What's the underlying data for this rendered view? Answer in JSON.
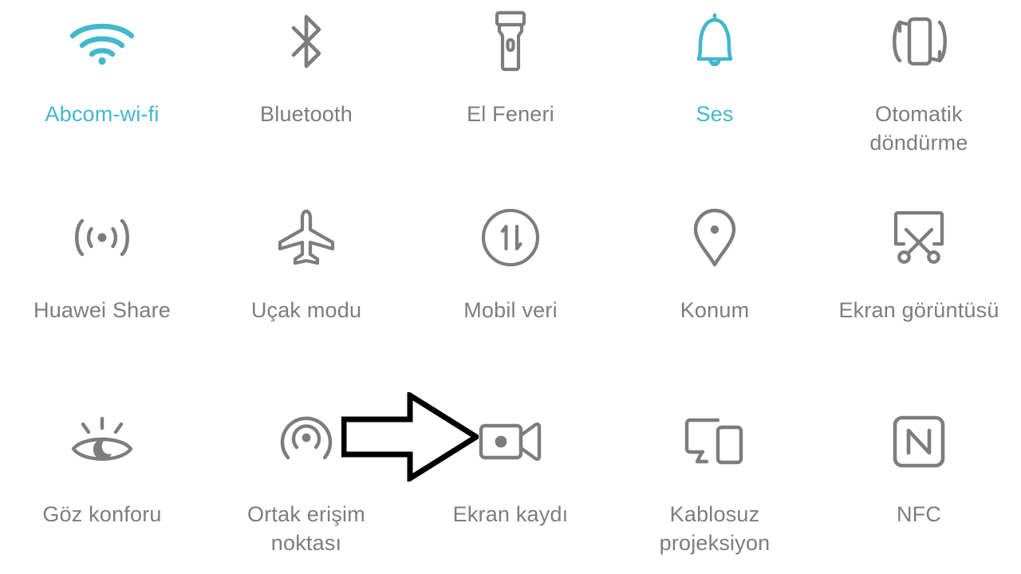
{
  "screen": {
    "title": "Quick Settings",
    "background_color": "#ffffff",
    "label_color": "#7d7d7d",
    "active_color": "#43b7cd",
    "icon_color": "#7d7d7d",
    "annotation_color": "#000000"
  },
  "annotation": {
    "name": "right-arrow-annotation",
    "points_to": "Ekran kaydı",
    "direction": "right"
  },
  "rows": [
    {
      "index": 1,
      "tiles": [
        {
          "id": "wifi",
          "label": "Abcom-wi-fi",
          "icon": "wifi-icon",
          "state": "on"
        },
        {
          "id": "bluetooth",
          "label": "Bluetooth",
          "icon": "bluetooth-icon",
          "state": "off"
        },
        {
          "id": "flashlight",
          "label": "El Feneri",
          "icon": "flashlight-icon",
          "state": "off"
        },
        {
          "id": "sound",
          "label": "Ses",
          "icon": "bell-icon",
          "state": "on"
        },
        {
          "id": "autorotate",
          "label": "Otomatik\ndöndürme",
          "icon": "auto-rotate-icon",
          "state": "off"
        }
      ]
    },
    {
      "index": 2,
      "tiles": [
        {
          "id": "huawei-share",
          "label": "Huawei Share",
          "icon": "huawei-share-icon",
          "state": "off"
        },
        {
          "id": "airplane",
          "label": "Uçak modu",
          "icon": "airplane-icon",
          "state": "off"
        },
        {
          "id": "mobile-data",
          "label": "Mobil veri",
          "icon": "mobile-data-icon",
          "state": "off"
        },
        {
          "id": "location",
          "label": "Konum",
          "icon": "location-pin-icon",
          "state": "off"
        },
        {
          "id": "screenshot",
          "label": "Ekran görüntüsü",
          "icon": "screenshot-icon",
          "state": "off"
        }
      ]
    },
    {
      "index": 3,
      "tiles": [
        {
          "id": "eye-comfort",
          "label": "Göz konforu",
          "icon": "eye-comfort-icon",
          "state": "off"
        },
        {
          "id": "hotspot",
          "label": "Ortak erişim\nnoktası",
          "icon": "hotspot-icon",
          "state": "off"
        },
        {
          "id": "screenrecord",
          "label": "Ekran kaydı",
          "icon": "screen-record-icon",
          "state": "off"
        },
        {
          "id": "projection",
          "label": "Kablosuz\nprojeksiyon",
          "icon": "wireless-cast-icon",
          "state": "off"
        },
        {
          "id": "nfc",
          "label": "NFC",
          "icon": "nfc-icon",
          "state": "off"
        }
      ]
    }
  ]
}
